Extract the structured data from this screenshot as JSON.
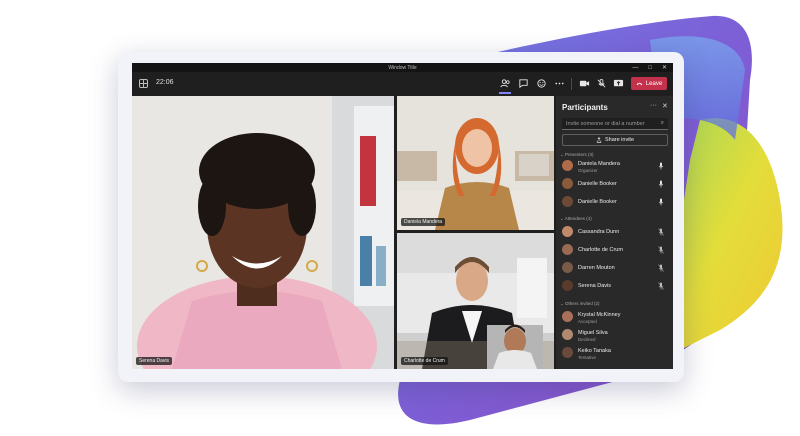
{
  "window": {
    "title": "Window Title",
    "minimize": "—",
    "maximize": "□",
    "close": "✕"
  },
  "toolbar": {
    "timer": "22:06",
    "icons": [
      "people-icon",
      "chat-icon",
      "react-icon",
      "more-icon",
      "camera-icon",
      "mic-off-icon",
      "share-icon"
    ],
    "leave_label": "Leave",
    "leave_color": "#c4314b"
  },
  "stage": {
    "tiles": [
      {
        "name": "Serena Davis"
      },
      {
        "name": "Daniela Mandera"
      },
      {
        "name": "Charlotte de Crum"
      }
    ]
  },
  "participants": {
    "title": "Participants",
    "more": "···",
    "close": "✕",
    "invite_placeholder": "Invite someone or dial a number",
    "share_label": "Share invite",
    "sections": [
      {
        "header": "Presenters (3)",
        "people": [
          {
            "name": "Daniela Mandera",
            "role": "Organizer",
            "mic": "on",
            "color": "#b06b4a"
          },
          {
            "name": "Danielle Booker",
            "role": "",
            "mic": "on",
            "color": "#8a5a3c"
          },
          {
            "name": "Danielle Booker",
            "role": "",
            "mic": "on",
            "color": "#6e4a36"
          }
        ]
      },
      {
        "header": "Attendees (4)",
        "people": [
          {
            "name": "Cassandra Dunn",
            "role": "",
            "mic": "off",
            "color": "#c08a6a"
          },
          {
            "name": "Charlotte de Crum",
            "role": "",
            "mic": "off",
            "color": "#9a6a52"
          },
          {
            "name": "Darren Mouton",
            "role": "",
            "mic": "off",
            "color": "#7a5a48"
          },
          {
            "name": "Serena Davis",
            "role": "",
            "mic": "off",
            "color": "#5a3a2a"
          }
        ]
      },
      {
        "header": "Others invited (2)",
        "people": [
          {
            "name": "Krystal McKinney",
            "role": "Accepted",
            "mic": "",
            "color": "#a87058"
          },
          {
            "name": "Miguel Silva",
            "role": "Declined",
            "mic": "",
            "color": "#b08a70"
          },
          {
            "name": "Keiko Tanaka",
            "role": "Tentative",
            "mic": "",
            "color": "#6a4a3a"
          }
        ]
      }
    ]
  },
  "colors": {
    "panel_bg": "#292929",
    "window_bg": "#1f1f1f",
    "blob_purple": "#7b74e0",
    "blob_yellow": "#e8df3a"
  }
}
